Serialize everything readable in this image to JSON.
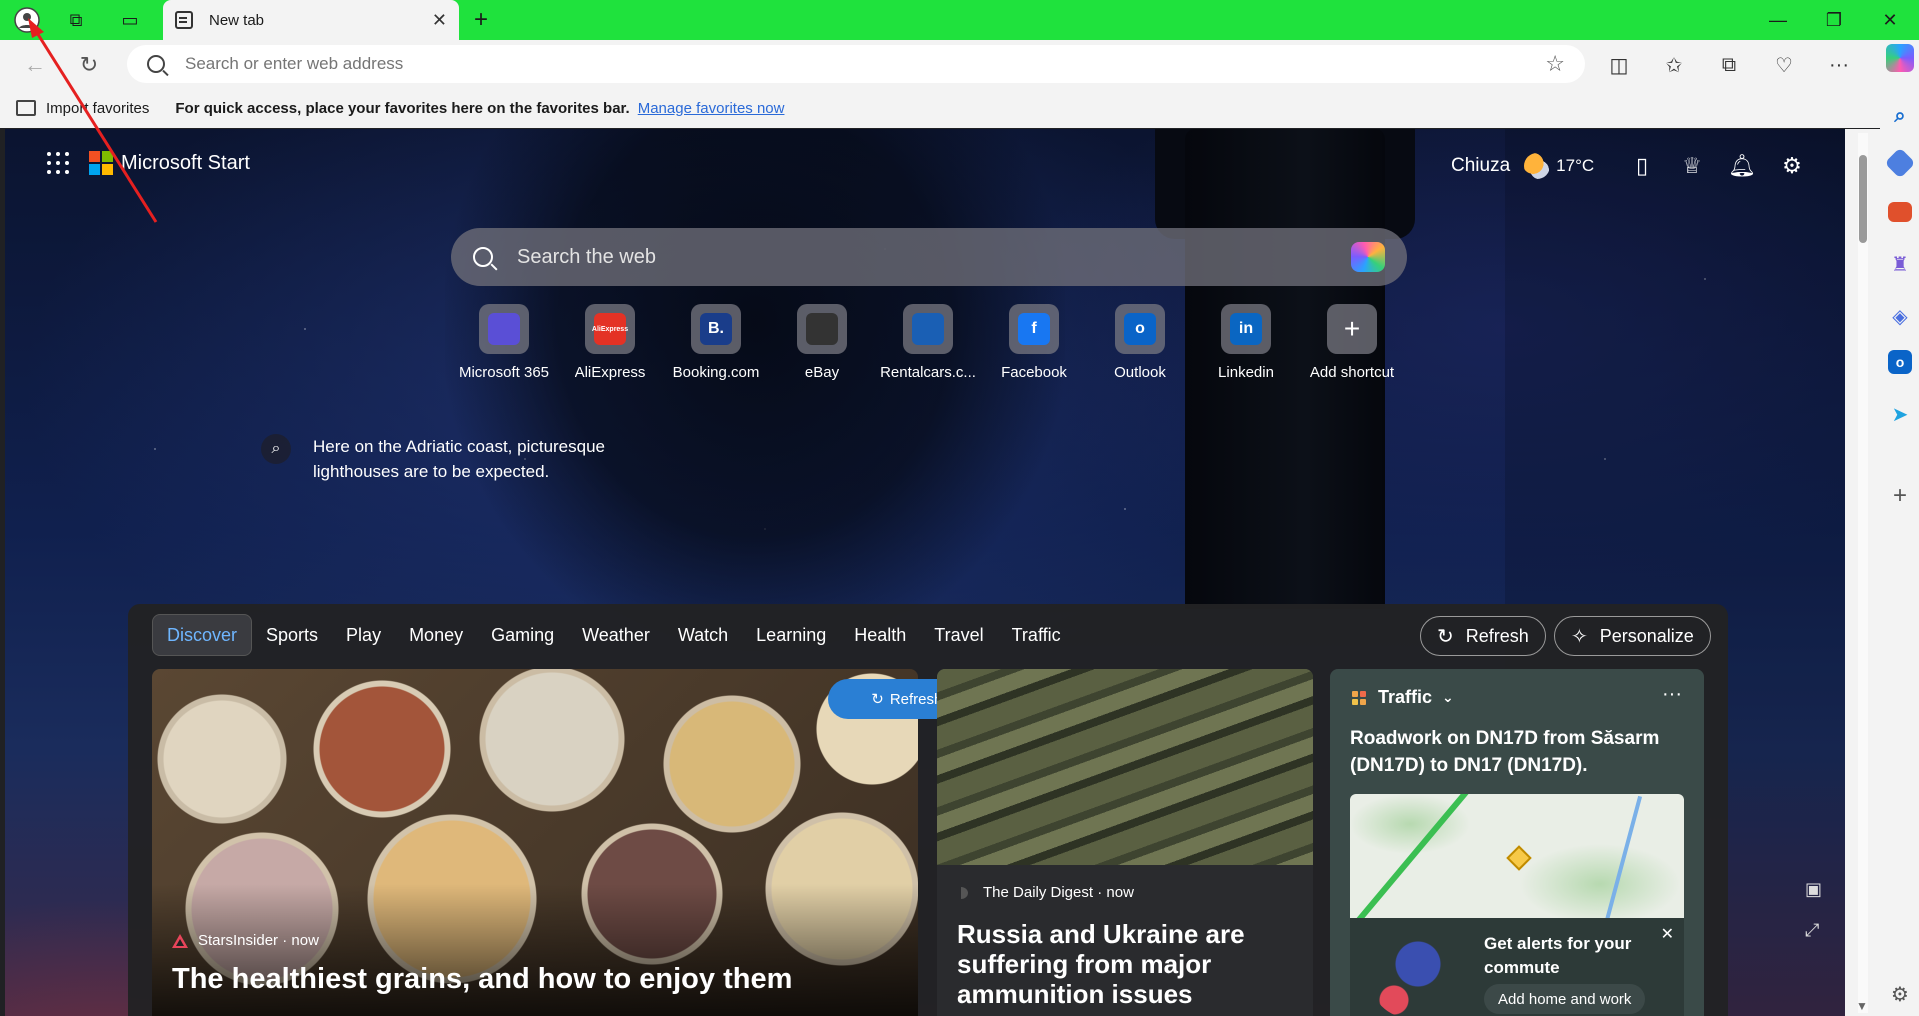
{
  "browser": {
    "tab_title": "New tab",
    "address_placeholder": "Search or enter web address",
    "favorites_bar": {
      "import_label": "Import favorites",
      "hint": "For quick access, place your favorites here on the favorites bar.",
      "manage_link": "Manage favorites now"
    },
    "accent_color": "#1fe23d"
  },
  "start": {
    "brand": "Microsoft Start",
    "location": "Chiuza",
    "temperature": "17°C",
    "search_placeholder": "Search the web",
    "shortcuts": [
      {
        "label": "Microsoft 365",
        "glyph": "",
        "color": "#5a4fd6"
      },
      {
        "label": "AliExpress",
        "glyph": "AliExpress",
        "color": "#e43225"
      },
      {
        "label": "Booking.com",
        "glyph": "B.",
        "color": "#1a3d8a"
      },
      {
        "label": "eBay",
        "glyph": "",
        "color": "#333333"
      },
      {
        "label": "Rentalcars.c...",
        "glyph": "",
        "color": "#1a5fb4"
      },
      {
        "label": "Facebook",
        "glyph": "f",
        "color": "#1877f2"
      },
      {
        "label": "Outlook",
        "glyph": "o",
        "color": "#0a64c8"
      },
      {
        "label": "Linkedin",
        "glyph": "in",
        "color": "#0a66c2"
      },
      {
        "label": "Add shortcut",
        "glyph": "+",
        "color": "transparent"
      }
    ],
    "image_caption": "Here on the Adriatic coast, picturesque lighthouses are to be expected."
  },
  "feed": {
    "tabs": [
      "Discover",
      "Sports",
      "Play",
      "Money",
      "Gaming",
      "Weather",
      "Watch",
      "Learning",
      "Health",
      "Travel",
      "Traffic"
    ],
    "refresh_label": "Refresh",
    "personalize_label": "Personalize",
    "refresh_stories_label": "Refresh stories",
    "cards": [
      {
        "source": "StarsInsider",
        "time": "now",
        "headline": "The healthiest grains, and how to enjoy them"
      },
      {
        "source": "The Daily Digest",
        "time": "now",
        "headline": "Russia and Ukraine are suffering from major ammunition issues"
      }
    ],
    "traffic": {
      "title": "Traffic",
      "headline": "Roadwork on DN17D from Săsarm (DN17D) to DN17 (DN17D).",
      "alert_title": "Get alerts for your commute",
      "alert_button": "Add home and work"
    }
  }
}
